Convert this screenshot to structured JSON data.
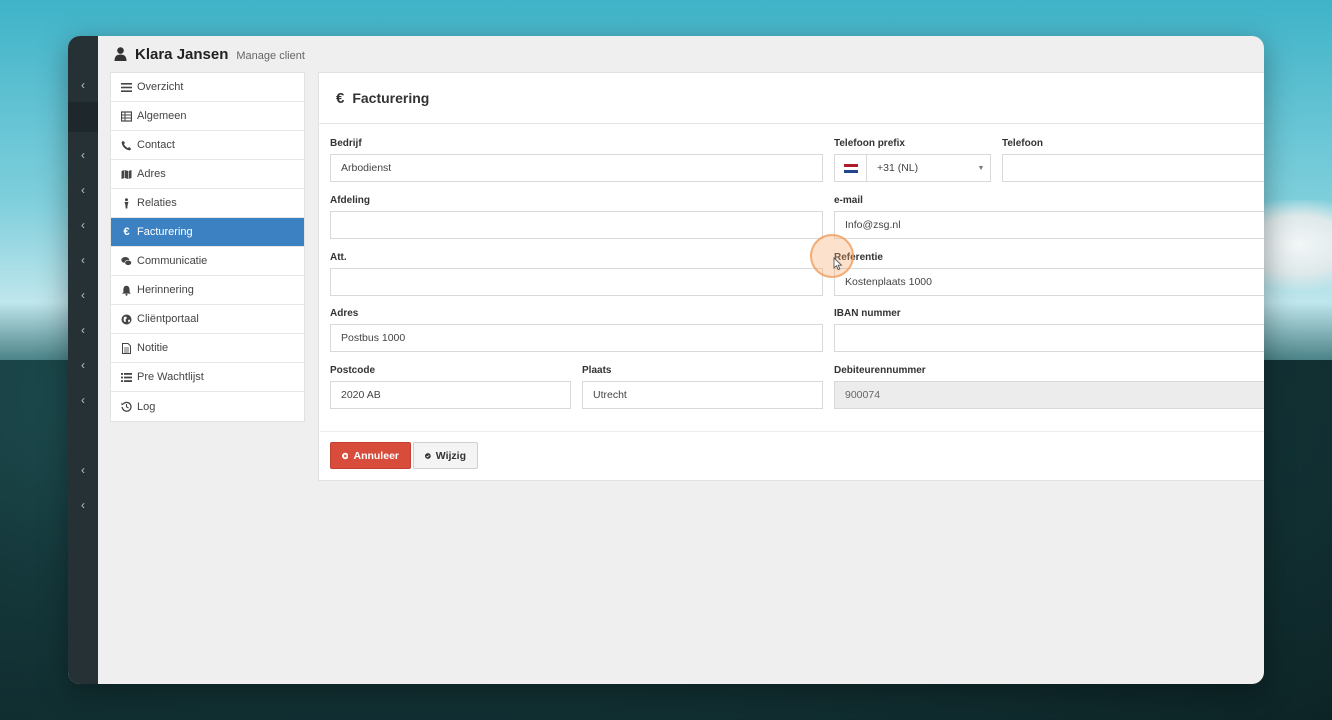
{
  "header": {
    "title": "Klara Jansen",
    "subtitle": "Manage client"
  },
  "rail": {
    "chevron": "‹"
  },
  "sidebar": {
    "items": [
      {
        "label": "Overzicht",
        "icon": "list-icon"
      },
      {
        "label": "Algemeen",
        "icon": "table-icon"
      },
      {
        "label": "Contact",
        "icon": "phone-icon"
      },
      {
        "label": "Adres",
        "icon": "map-icon"
      },
      {
        "label": "Relaties",
        "icon": "relations-icon"
      },
      {
        "label": "Facturering",
        "icon": "euro-icon",
        "active": true
      },
      {
        "label": "Communicatie",
        "icon": "comments-icon"
      },
      {
        "label": "Herinnering",
        "icon": "bell-icon"
      },
      {
        "label": "Cliëntportaal",
        "icon": "globe-icon"
      },
      {
        "label": "Notitie",
        "icon": "note-icon"
      },
      {
        "label": "Pre Wachtlijst",
        "icon": "list-alt-icon"
      },
      {
        "label": "Log",
        "icon": "history-icon"
      }
    ]
  },
  "panel": {
    "icon_glyph": "€",
    "title": "Facturering"
  },
  "form": {
    "bedrijf": {
      "label": "Bedrijf",
      "value": "Arbodienst"
    },
    "telefoon_prefix": {
      "label": "Telefoon prefix",
      "value": "+31 (NL)"
    },
    "telefoon": {
      "label": "Telefoon",
      "value": ""
    },
    "afdeling": {
      "label": "Afdeling",
      "value": ""
    },
    "email": {
      "label": "e-mail",
      "value": "Info@zsg.nl"
    },
    "att": {
      "label": "Att.",
      "value": ""
    },
    "referentie": {
      "label": "Referentie",
      "value": "Kostenplaats 1000"
    },
    "adres": {
      "label": "Adres",
      "value": "Postbus 1000"
    },
    "iban": {
      "label": "IBAN nummer",
      "value": ""
    },
    "postcode": {
      "label": "Postcode",
      "value": "2020 AB"
    },
    "plaats": {
      "label": "Plaats",
      "value": "Utrecht"
    },
    "debiteurennummer": {
      "label": "Debiteurennummer",
      "value": "900074"
    }
  },
  "buttons": {
    "cancel": "Annuleer",
    "edit": "Wijzig"
  },
  "colors": {
    "accent": "#3c82c3",
    "danger": "#d84c3c",
    "rail": "#263136"
  }
}
